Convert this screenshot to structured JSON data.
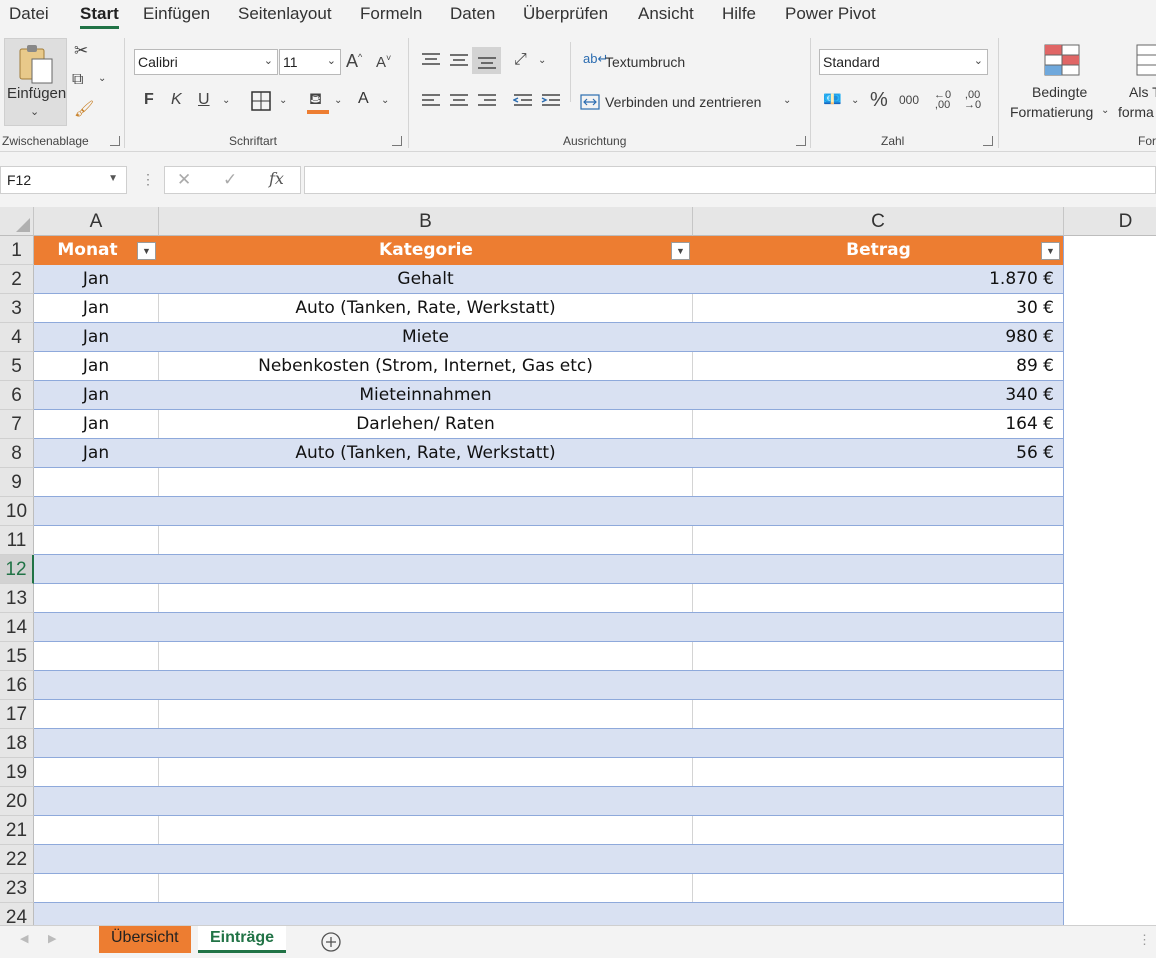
{
  "menu": {
    "tabs": [
      "Datei",
      "Start",
      "Einfügen",
      "Seitenlayout",
      "Formeln",
      "Daten",
      "Überprüfen",
      "Ansicht",
      "Hilfe",
      "Power Pivot"
    ],
    "active": "Start"
  },
  "ribbon": {
    "clipboard": {
      "paste_label": "Einfügen",
      "group_label": "Zwischenablage"
    },
    "font": {
      "font_name": "Calibri",
      "font_size": "11",
      "bold": "F",
      "italic": "K",
      "underline": "U",
      "grow": "A",
      "shrink": "A",
      "color_a": "A",
      "group_label": "Schriftart"
    },
    "alignment": {
      "wrap_label": "Textumbruch",
      "merge_label": "Verbinden und zentrieren",
      "group_label": "Ausrichtung"
    },
    "number": {
      "format": "Standard",
      "percent": "%",
      "thousands": "000",
      "group_label": "Zahl"
    },
    "styles": {
      "cond_line1": "Bedingte",
      "cond_line2": "Formatierung",
      "astable_line1": "Als T",
      "astable_line2": "forma",
      "next_group_label": "For"
    }
  },
  "formula_bar": {
    "name_box": "F12",
    "formula": ""
  },
  "columns": [
    "A",
    "B",
    "C",
    "D"
  ],
  "table": {
    "headers": [
      "Monat",
      "Kategorie",
      "Betrag"
    ],
    "rows": [
      [
        "Jan",
        "Gehalt",
        "1.870 €"
      ],
      [
        "Jan",
        "Auto (Tanken, Rate, Werkstatt)",
        "30 €"
      ],
      [
        "Jan",
        "Miete",
        "980 €"
      ],
      [
        "Jan",
        "Nebenkosten (Strom, Internet, Gas etc)",
        "89 €"
      ],
      [
        "Jan",
        "Mieteinnahmen",
        "340 €"
      ],
      [
        "Jan",
        "Darlehen/ Raten",
        "164 €"
      ],
      [
        "Jan",
        "Auto (Tanken, Rate, Werkstatt)",
        "56 €"
      ]
    ]
  },
  "row_numbers": [
    "1",
    "2",
    "3",
    "4",
    "5",
    "6",
    "7",
    "8",
    "9",
    "10",
    "11",
    "12",
    "13",
    "14",
    "15",
    "16",
    "17",
    "18",
    "19",
    "20",
    "21",
    "22",
    "23",
    "24"
  ],
  "selected_row": "12",
  "sheets": {
    "tabs": [
      "Übersicht",
      "Einträge"
    ],
    "active": "Einträge"
  },
  "colors": {
    "accent": "#217346",
    "table_header": "#ed7d31",
    "band": "#d9e1f2",
    "tab_orange": "#ed7d31"
  }
}
